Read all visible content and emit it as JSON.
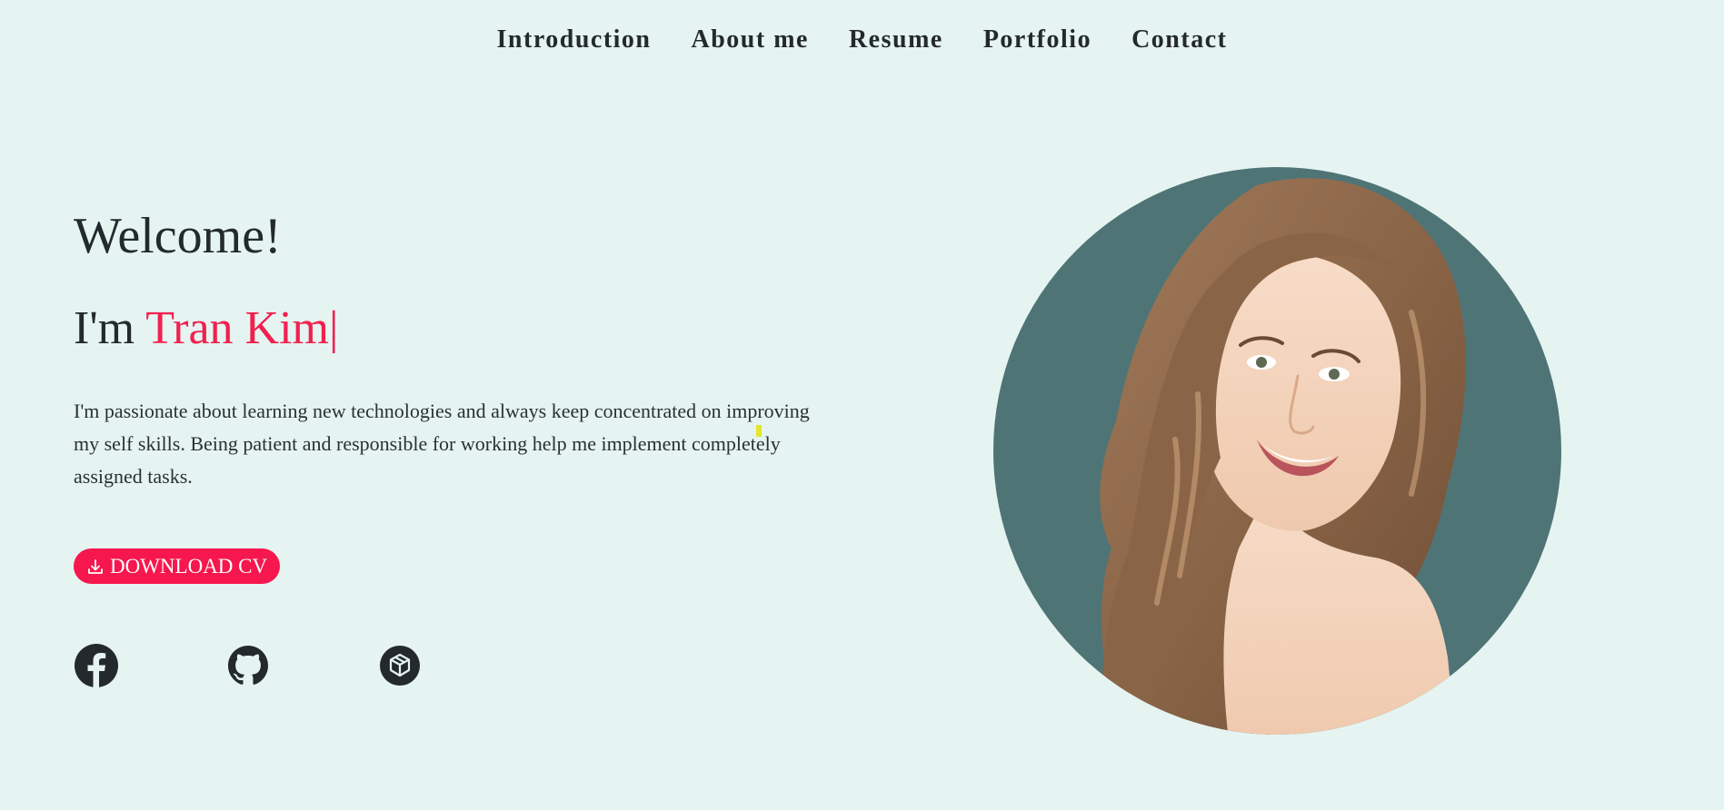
{
  "nav": {
    "items": [
      "Introduction",
      "About me",
      "Resume",
      "Portfolio",
      "Contact"
    ]
  },
  "hero": {
    "welcome": "Welcome!",
    "intro_prefix": "I'm ",
    "name": "Tran Kim",
    "cursor": "|",
    "description": "I'm passionate about learning new technologies and always keep concentrated on improving my self skills. Being patient and responsible for working help me implement completely assigned tasks.",
    "download_label": "DOWNLOAD CV"
  },
  "social": {
    "icons": [
      "facebook-icon",
      "github-icon",
      "codepen-icon"
    ]
  },
  "colors": {
    "background": "#e5f4f1",
    "accent": "#f0214f",
    "text": "#222a2e",
    "portrait_bg": "#4f7476"
  }
}
